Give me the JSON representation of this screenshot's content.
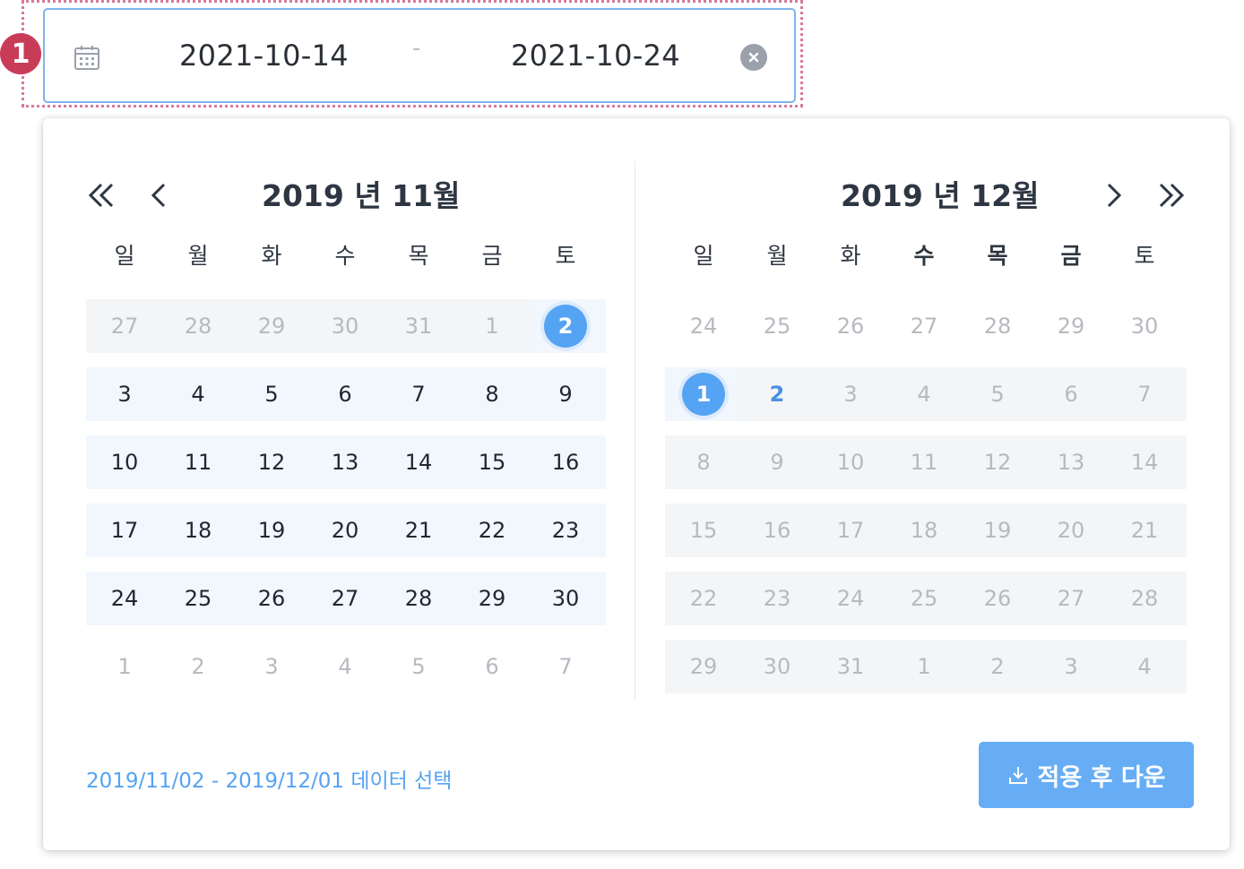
{
  "annotation": {
    "badge": "1"
  },
  "range_input": {
    "start": "2021-10-14",
    "separator": "-",
    "end": "2021-10-24"
  },
  "left_calendar": {
    "title": "2019 년 11월",
    "weekdays": [
      "일",
      "월",
      "화",
      "수",
      "목",
      "금",
      "토"
    ],
    "weeks": [
      [
        "27",
        "28",
        "29",
        "30",
        "31",
        "1",
        "2"
      ],
      [
        "3",
        "4",
        "5",
        "6",
        "7",
        "8",
        "9"
      ],
      [
        "10",
        "11",
        "12",
        "13",
        "14",
        "15",
        "16"
      ],
      [
        "17",
        "18",
        "19",
        "20",
        "21",
        "22",
        "23"
      ],
      [
        "24",
        "25",
        "26",
        "27",
        "28",
        "29",
        "30"
      ],
      [
        "1",
        "2",
        "3",
        "4",
        "5",
        "6",
        "7"
      ]
    ]
  },
  "right_calendar": {
    "title": "2019 년 12월",
    "weekdays": [
      "일",
      "월",
      "화",
      "수",
      "목",
      "금",
      "토"
    ],
    "weeks": [
      [
        "24",
        "25",
        "26",
        "27",
        "28",
        "29",
        "30"
      ],
      [
        "1",
        "2",
        "3",
        "4",
        "5",
        "6",
        "7"
      ],
      [
        "8",
        "9",
        "10",
        "11",
        "12",
        "13",
        "14"
      ],
      [
        "15",
        "16",
        "17",
        "18",
        "19",
        "20",
        "21"
      ],
      [
        "22",
        "23",
        "24",
        "25",
        "26",
        "27",
        "28"
      ],
      [
        "29",
        "30",
        "31",
        "1",
        "2",
        "3",
        "4"
      ]
    ]
  },
  "footer": {
    "selection_text": "2019/11/02 - 2019/12/01 데이터 선택",
    "apply_label": "적용 후 다운"
  },
  "colors": {
    "accent": "#55a3f3",
    "range_bg": "#f2f7fe",
    "disabled_bg": "#f4f5f6",
    "annotation": "#c93c57"
  }
}
